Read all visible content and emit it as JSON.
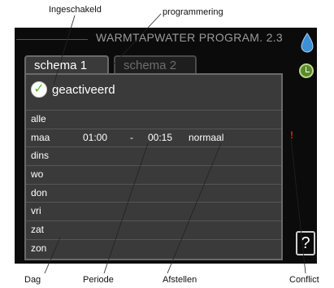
{
  "annotations": {
    "top": [
      "Ingeschakeld",
      "programmering"
    ],
    "bottom": [
      "Dag",
      "Periode",
      "Afstellen",
      "Conflict"
    ]
  },
  "screen": {
    "title": "WARMTAPWATER PROGRAM. 2.3",
    "tabs": [
      {
        "label": "schema 1",
        "active": true
      },
      {
        "label": "schema 2",
        "active": false
      }
    ],
    "activated_label": "geactiveerd",
    "rows": [
      {
        "day": "alle",
        "start": "",
        "dash": "",
        "end": "",
        "mode": ""
      },
      {
        "day": "maa",
        "start": "01:00",
        "dash": "-",
        "end": "00:15",
        "mode": "normaal"
      },
      {
        "day": "dins",
        "start": "",
        "dash": "",
        "end": "",
        "mode": ""
      },
      {
        "day": "wo",
        "start": "",
        "dash": "",
        "end": "",
        "mode": ""
      },
      {
        "day": "don",
        "start": "",
        "dash": "",
        "end": "",
        "mode": ""
      },
      {
        "day": "vri",
        "start": "",
        "dash": "",
        "end": "",
        "mode": ""
      },
      {
        "day": "zat",
        "start": "",
        "dash": "",
        "end": "",
        "mode": ""
      },
      {
        "day": "zon",
        "start": "",
        "dash": "",
        "end": "",
        "mode": ""
      }
    ],
    "conflict_mark": "!",
    "help_label": "?"
  },
  "icons": {
    "water": "water-drop-icon",
    "clock": "clock-icon",
    "help": "help-icon",
    "check": "checkmark-icon"
  },
  "colors": {
    "screen_bg": "#0b0b0b",
    "panel_bg": "#3a3a3a",
    "check_green": "#5cb82c",
    "drop_blue": "#3d8fd6",
    "conflict_red": "#e52222"
  }
}
